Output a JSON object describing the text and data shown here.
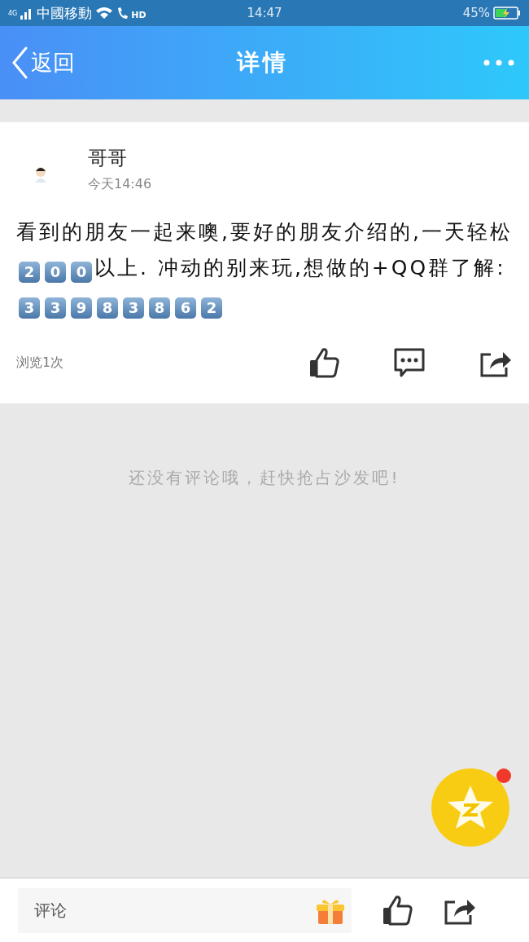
{
  "status_bar": {
    "network": "4G",
    "carrier": "中國移動",
    "call_badge": "HD",
    "time": "14:47",
    "battery": "45%"
  },
  "nav": {
    "back": "返回",
    "title": "详情"
  },
  "post": {
    "author": "哥哥",
    "time": "今天14:46",
    "body": [
      {
        "kind": "text",
        "text": "看到的朋友一起来噢,要好的朋友介绍的,一天轻松"
      },
      {
        "kind": "keycap",
        "text": "2"
      },
      {
        "kind": "keycap",
        "text": "0"
      },
      {
        "kind": "keycap",
        "text": "0"
      },
      {
        "kind": "text",
        "text": "以上. 冲动的别来玩,想做的+QQ群了解:"
      },
      {
        "kind": "keycap",
        "text": "3"
      },
      {
        "kind": "keycap",
        "text": "3"
      },
      {
        "kind": "keycap",
        "text": "9"
      },
      {
        "kind": "keycap",
        "text": "8"
      },
      {
        "kind": "keycap",
        "text": "3"
      },
      {
        "kind": "keycap",
        "text": "8"
      },
      {
        "kind": "keycap",
        "text": "6"
      },
      {
        "kind": "keycap",
        "text": "2"
      }
    ],
    "views": "浏览1次"
  },
  "comments_empty": "还没有评论哦，赶快抢占沙发吧!",
  "floating_button": {
    "badge": true
  },
  "comment_bar": {
    "placeholder": "评论"
  }
}
